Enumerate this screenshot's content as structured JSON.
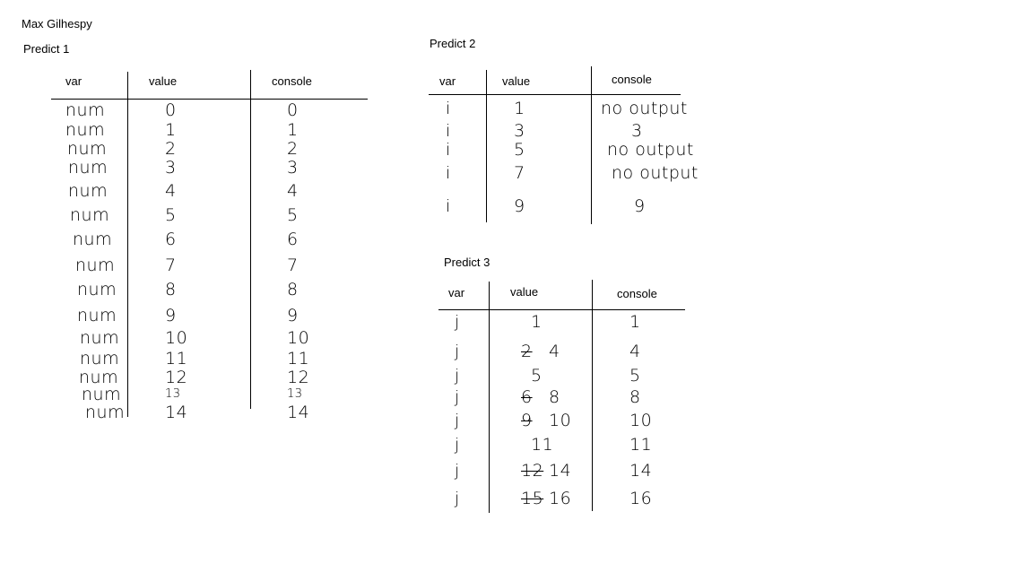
{
  "author": "Max Gilhespy",
  "predict1": {
    "title": "Predict 1",
    "headers": {
      "var": "var",
      "value": "value",
      "console": "console"
    },
    "rows": [
      {
        "var": "num",
        "value": "0",
        "console": "0"
      },
      {
        "var": "num",
        "value": "1",
        "console": "1"
      },
      {
        "var": "num",
        "value": "2",
        "console": "2"
      },
      {
        "var": "num",
        "value": "3",
        "console": "3"
      },
      {
        "var": "num",
        "value": "4",
        "console": "4"
      },
      {
        "var": "num",
        "value": "5",
        "console": "5"
      },
      {
        "var": "num",
        "value": "6",
        "console": "6"
      },
      {
        "var": "num",
        "value": "7",
        "console": "7"
      },
      {
        "var": "num",
        "value": "8",
        "console": "8"
      },
      {
        "var": "num",
        "value": "9",
        "console": "9"
      },
      {
        "var": "num",
        "value": "10",
        "console": "10"
      },
      {
        "var": "num",
        "value": "11",
        "console": "11"
      },
      {
        "var": "num",
        "value": "12",
        "console": "12"
      },
      {
        "var": "num",
        "value": "13",
        "console": "13"
      },
      {
        "var": "num",
        "value": "14",
        "console": "14"
      }
    ]
  },
  "predict2": {
    "title": "Predict 2",
    "headers": {
      "var": "var",
      "value": "value",
      "console": "console"
    },
    "rows": [
      {
        "var": "i",
        "value": "1",
        "console": "no output"
      },
      {
        "var": "i",
        "value": "3",
        "console": "3"
      },
      {
        "var": "i",
        "value": "5",
        "console": "no output"
      },
      {
        "var": "i",
        "value": "7",
        "console": "no output"
      },
      {
        "var": "i",
        "value": "9",
        "console": "9"
      }
    ]
  },
  "predict3": {
    "title": "Predict 3",
    "headers": {
      "var": "var",
      "value": "value",
      "console": "console"
    },
    "rows": [
      {
        "var": "j",
        "struck": "",
        "value": "1",
        "console": "1"
      },
      {
        "var": "j",
        "struck": "2",
        "value": "4",
        "console": "4"
      },
      {
        "var": "j",
        "struck": "",
        "value": "5",
        "console": "5"
      },
      {
        "var": "j",
        "struck": "6",
        "value": "8",
        "console": "8"
      },
      {
        "var": "j",
        "struck": "9",
        "value": "10",
        "console": "10"
      },
      {
        "var": "j",
        "struck": "",
        "value": "11",
        "console": "11"
      },
      {
        "var": "j",
        "struck": "12",
        "value": "14",
        "console": "14"
      },
      {
        "var": "j",
        "struck": "15",
        "value": "16",
        "console": "16"
      }
    ]
  }
}
